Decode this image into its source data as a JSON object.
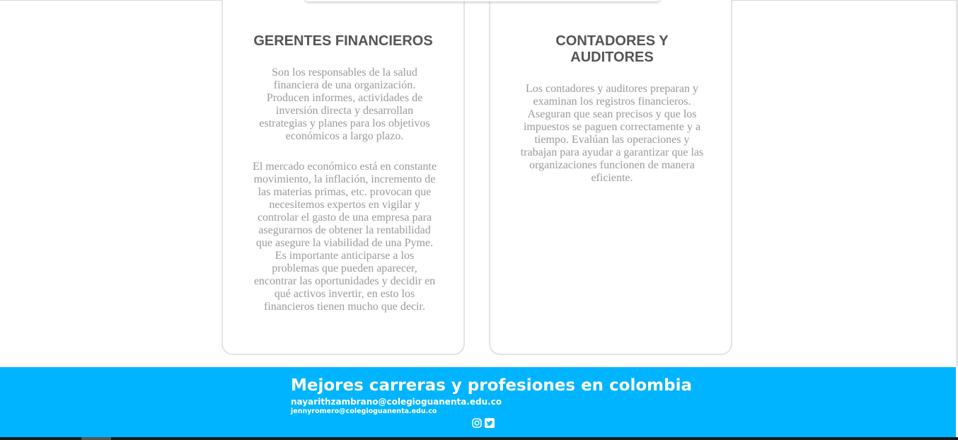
{
  "cards": [
    {
      "title": "GERENTES FINANCIEROS",
      "paragraphs": [
        "Son los responsables de la salud financiera de una organización. Producen informes, actividades de inversión directa y desarrollan estrategias y planes para los objetivos económicos a largo plazo.",
        "El mercado económico está en constante movimiento, la inflación, incremento de las materias primas, etc. provocan que necesitemos expertos en vigilar y controlar el gasto de una empresa para asegurarnos de obtener la rentabilidad que asegure la viabilidad de una Pyme. Es importante anticiparse a los problemas que pueden aparecer, encontrar las oportunidades y decidir en qué activos invertir, en esto los financieros tienen mucho que decir."
      ]
    },
    {
      "title": "CONTADORES Y AUDITORES",
      "paragraphs": [
        "Los contadores y auditores preparan y examinan los registros financieros. Aseguran que sean precisos y que los impuestos se paguen correctamente y a tiempo. Evalúan las operaciones y trabajan para ayudar a garantizar que las organizaciones funcionen de manera eficiente."
      ]
    }
  ],
  "footer": {
    "title": "Mejores carreras y profesiones en colombia",
    "email_1": "nayarithzambrano@colegioguanenta.edu.co",
    "email_2": "jennyromero@colegioguanenta.edu.co",
    "social_icons": [
      "instagram-icon",
      "twitter-icon"
    ],
    "background_color": "#00b4ff"
  }
}
